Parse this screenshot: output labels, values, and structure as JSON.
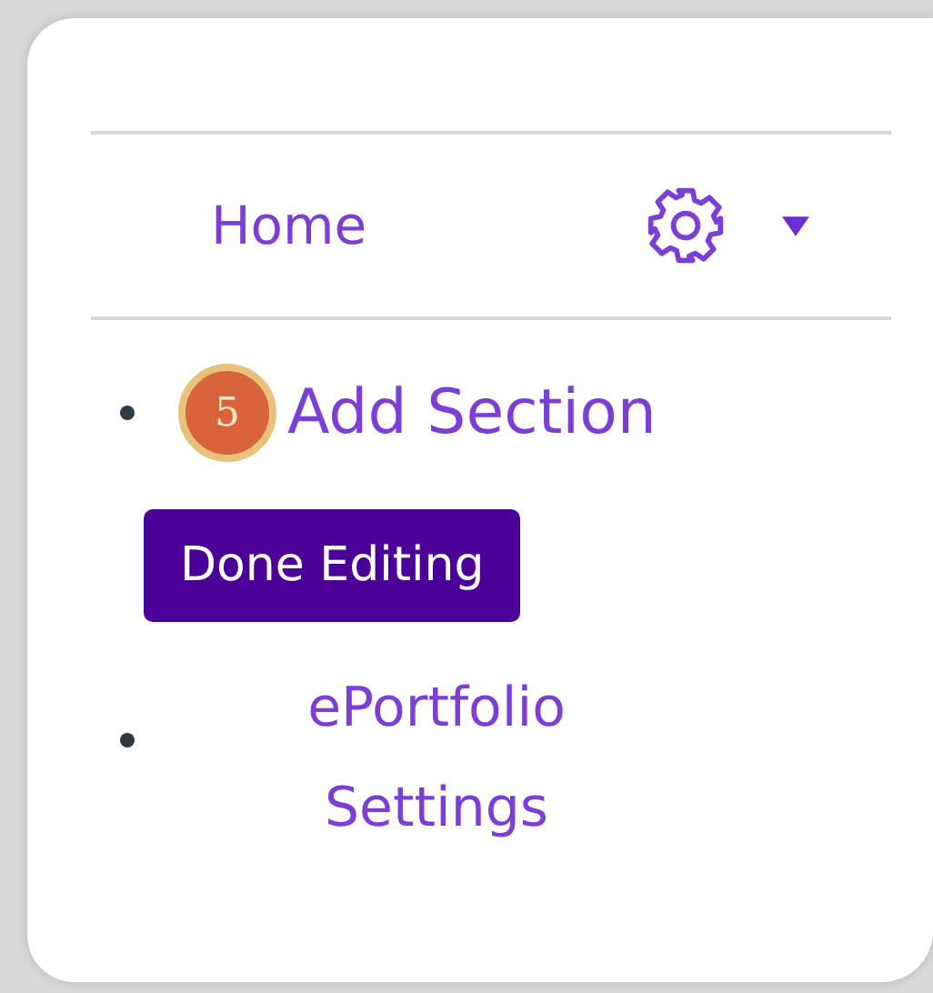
{
  "nav": {
    "home_link": "Home"
  },
  "list": [
    {
      "kind": "link",
      "label": "Add Section",
      "step_badge": "5"
    },
    {
      "kind": "button",
      "label": "Done Editing"
    },
    {
      "kind": "link",
      "label": "ePortfolio Settings"
    }
  ]
}
